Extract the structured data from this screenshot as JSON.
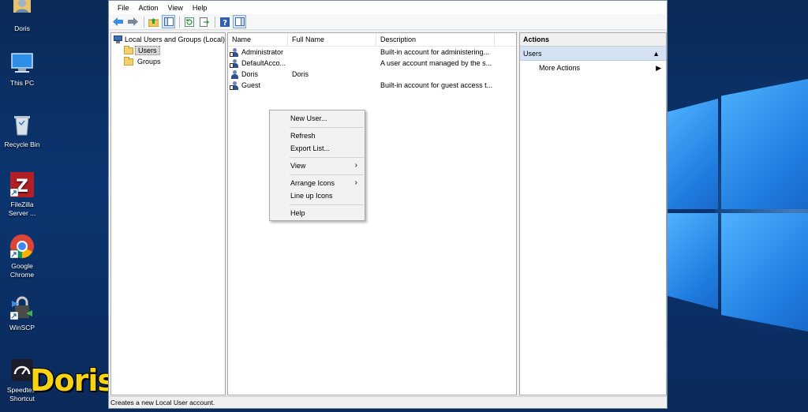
{
  "desktop": {
    "icons": [
      {
        "label": "Doris",
        "icon": "user-folder-icon"
      },
      {
        "label": "This PC",
        "icon": "computer-icon"
      },
      {
        "label": "Recycle Bin",
        "icon": "recycle-bin-icon"
      },
      {
        "label": "FileZilla Server ...",
        "icon": "filezilla-icon"
      },
      {
        "label": "Google Chrome",
        "icon": "chrome-icon"
      },
      {
        "label": "WinSCP",
        "icon": "winscp-icon"
      },
      {
        "label": "Speedtest Shortcut",
        "icon": "speedtest-icon"
      }
    ],
    "watermark": "Doris"
  },
  "window": {
    "menu": [
      "File",
      "Action",
      "View",
      "Help"
    ],
    "toolbar": [
      "back-icon",
      "forward-icon",
      "up-folder-icon",
      "show-hide-tree-icon",
      "refresh-icon",
      "export-list-icon",
      "help-icon",
      "show-hide-action-pane-icon"
    ],
    "tree": {
      "root": "Local Users and Groups (Local)",
      "children": [
        "Users",
        "Groups"
      ],
      "selected": "Users"
    },
    "list": {
      "columns": [
        "Name",
        "Full Name",
        "Description"
      ],
      "rows": [
        {
          "name": "Administrator",
          "full_name": "",
          "description": "Built-in account for administering..."
        },
        {
          "name": "DefaultAcco...",
          "full_name": "",
          "description": "A user account managed by the s..."
        },
        {
          "name": "Doris",
          "full_name": "Doris",
          "description": ""
        },
        {
          "name": "Guest",
          "full_name": "",
          "description": "Built-in account for guest access t..."
        }
      ]
    },
    "context_menu": {
      "new_user": "New User...",
      "refresh": "Refresh",
      "export_list": "Export List...",
      "view": "View",
      "arrange_icons": "Arrange Icons",
      "line_up_icons": "Line up Icons",
      "help": "Help"
    },
    "actions": {
      "header": "Actions",
      "section": "Users",
      "more_actions": "More Actions"
    },
    "status": "Creates a new Local User account."
  }
}
